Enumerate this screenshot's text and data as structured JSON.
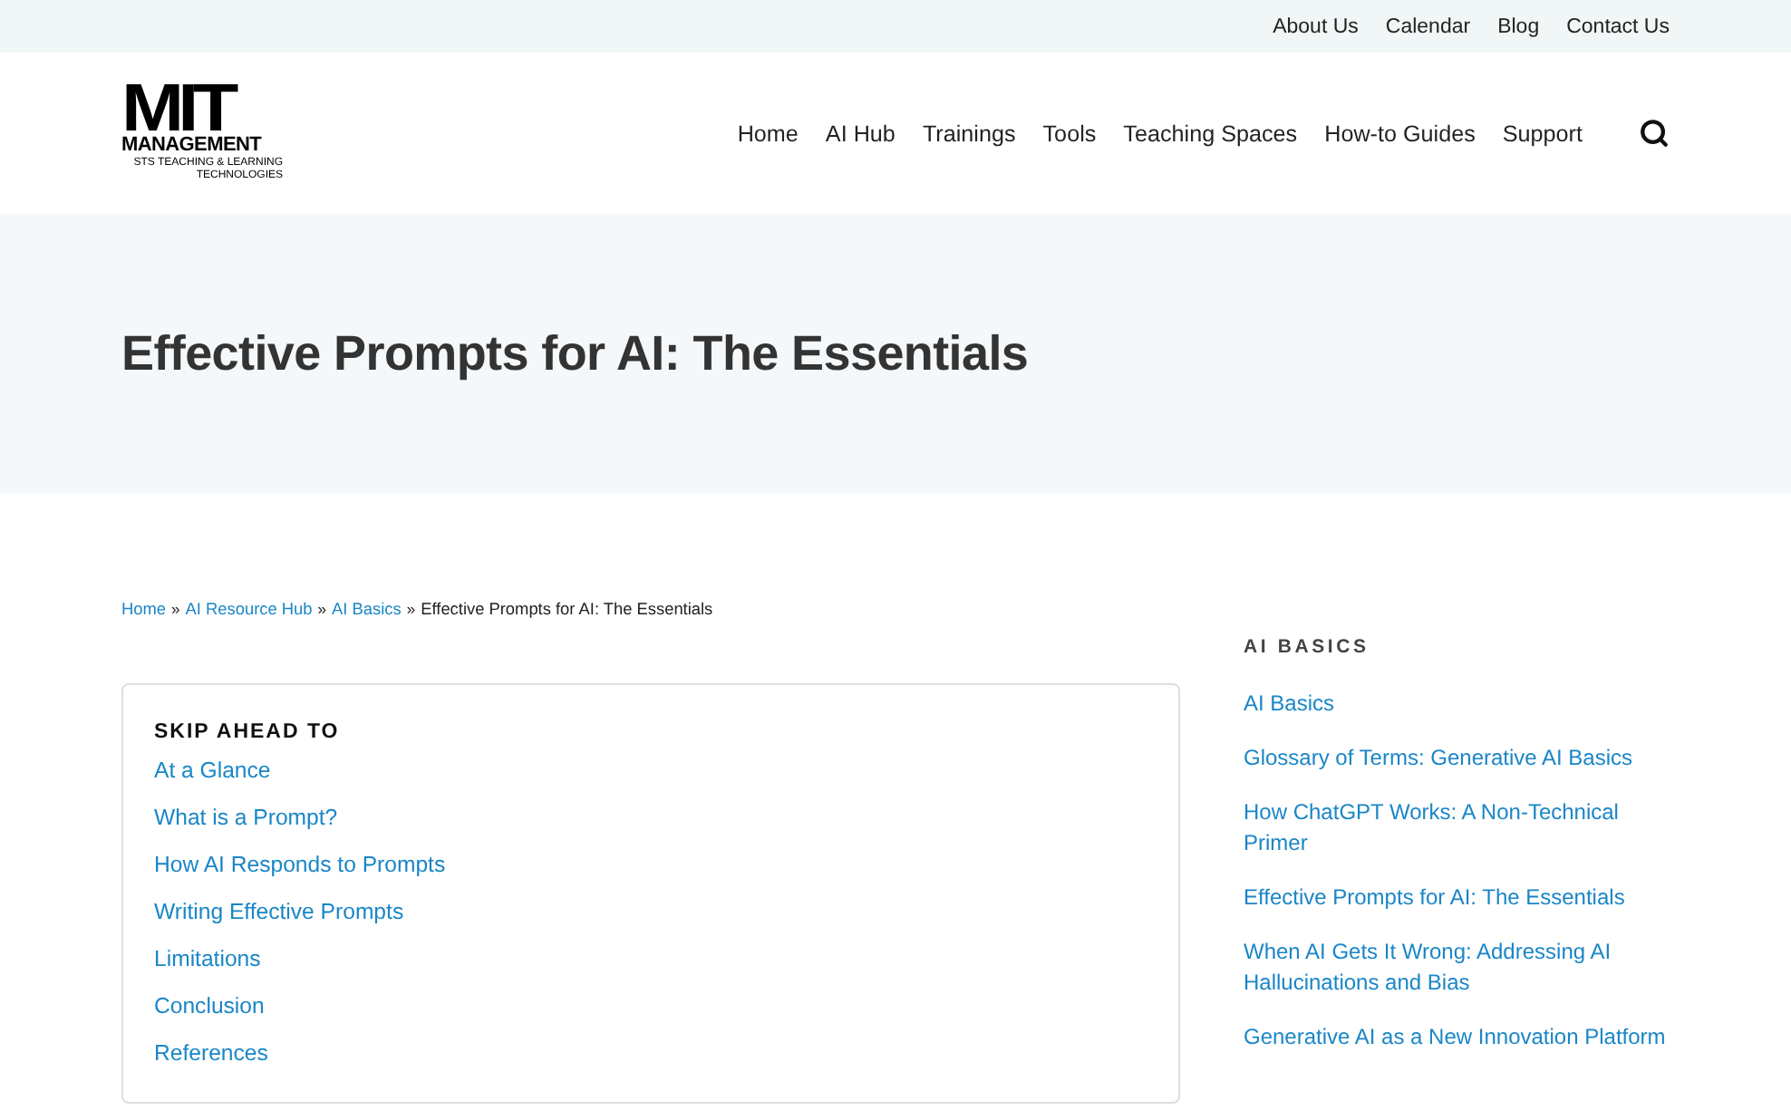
{
  "top_links": [
    "About Us",
    "Calendar",
    "Blog",
    "Contact Us"
  ],
  "logo": {
    "mark": "MIT",
    "name": "MANAGEMENT",
    "subtitle_lines": [
      "STS TEACHING & LEARNING",
      "TECHNOLOGIES"
    ]
  },
  "nav": {
    "items": [
      "Home",
      "AI Hub",
      "Trainings",
      "Tools",
      "Teaching Spaces",
      "How-to Guides",
      "Support"
    ]
  },
  "page_title": "Effective Prompts for AI: The Essentials",
  "breadcrumbs": [
    {
      "kind": "link",
      "label": "Home"
    },
    {
      "kind": "separator",
      "label": "»"
    },
    {
      "kind": "link",
      "label": "AI Resource Hub"
    },
    {
      "kind": "separator",
      "label": "»"
    },
    {
      "kind": "link",
      "label": "AI Basics"
    },
    {
      "kind": "separator",
      "label": "»"
    },
    {
      "kind": "current",
      "label": "Effective Prompts for AI: The Essentials"
    }
  ],
  "skip_ahead": {
    "heading": "SKIP AHEAD TO",
    "links": [
      "At a Glance",
      "What is a Prompt?",
      "How AI Responds to Prompts",
      "Writing Effective Prompts",
      "Limitations",
      "Conclusion",
      "References"
    ]
  },
  "sidebar": {
    "heading": "AI BASICS",
    "links": [
      "AI Basics",
      "Glossary of Terms: Generative AI Basics",
      "How ChatGPT Works: A Non-Technical Primer",
      "Effective Prompts for AI: The Essentials",
      "When AI Gets It Wrong: Addressing AI Hallucinations and Bias",
      "Generative AI as a New Innovation Platform"
    ]
  }
}
